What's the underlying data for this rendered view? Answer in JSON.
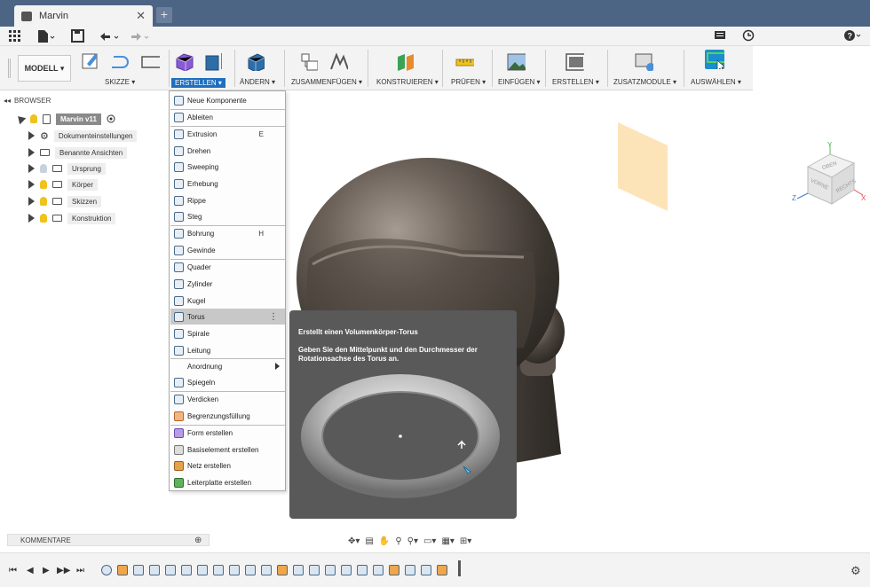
{
  "window": {
    "tab_title": "Marvin",
    "close_glyph": "✕",
    "new_tab_glyph": "+"
  },
  "quickbar": {
    "icons": [
      "grid-icon",
      "file-icon",
      "save-icon",
      "undo-icon",
      "redo-icon",
      "comment-icon",
      "clock-icon",
      "help-icon"
    ]
  },
  "ribbon": {
    "workspace": "MODELL ▾",
    "groups": [
      {
        "label": "SKIZZE ▾"
      },
      {
        "label": "ERSTELLEN ▾"
      },
      {
        "label": "ÄNDERN ▾"
      },
      {
        "label": "ZUSAMMENFÜGEN ▾"
      },
      {
        "label": "KONSTRUIEREN ▾"
      },
      {
        "label": "PRÜFEN ▾"
      },
      {
        "label": "EINFÜGEN ▾"
      },
      {
        "label": "ERSTELLEN ▾"
      },
      {
        "label": "ZUSATZMODULE ▾"
      },
      {
        "label": "AUSWÄHLEN ▾"
      }
    ]
  },
  "viewcube": {
    "top": "OBEN",
    "front": "VORNE",
    "right": "RECHTS",
    "axis_x": "X",
    "axis_y": "Y",
    "axis_z": "Z"
  },
  "browser": {
    "title": "BROWSER",
    "root": "Marvin v11",
    "items": [
      {
        "label": "Dokumenteinstellungen"
      },
      {
        "label": "Benannte Ansichten"
      },
      {
        "label": "Ursprung"
      },
      {
        "label": "Körper"
      },
      {
        "label": "Skizzen"
      },
      {
        "label": "Konstruktion"
      }
    ]
  },
  "menu": {
    "items": [
      {
        "label": "Neue Komponente",
        "key": "",
        "icon": "new-component-icon"
      },
      {
        "label": "Ableiten",
        "key": "",
        "icon": "derive-icon"
      },
      {
        "label": "Extrusion",
        "key": "E",
        "icon": "extrude-icon"
      },
      {
        "label": "Drehen",
        "key": "",
        "icon": "revolve-icon"
      },
      {
        "label": "Sweeping",
        "key": "",
        "icon": "sweep-icon"
      },
      {
        "label": "Erhebung",
        "key": "",
        "icon": "loft-icon"
      },
      {
        "label": "Rippe",
        "key": "",
        "icon": "rib-icon"
      },
      {
        "label": "Steg",
        "key": "",
        "icon": "web-icon"
      },
      {
        "label": "Bohrung",
        "key": "H",
        "icon": "hole-icon"
      },
      {
        "label": "Gewinde",
        "key": "",
        "icon": "thread-icon"
      },
      {
        "label": "Quader",
        "key": "",
        "icon": "box-icon"
      },
      {
        "label": "Zylinder",
        "key": "",
        "icon": "cylinder-icon"
      },
      {
        "label": "Kugel",
        "key": "",
        "icon": "sphere-icon"
      },
      {
        "label": "Torus",
        "key": "",
        "icon": "torus-icon"
      },
      {
        "label": "Spirale",
        "key": "",
        "icon": "coil-icon"
      },
      {
        "label": "Leitung",
        "key": "",
        "icon": "pipe-icon"
      },
      {
        "label": "Anordnung",
        "key": "",
        "icon": "pattern-icon"
      },
      {
        "label": "Spiegeln",
        "key": "",
        "icon": "mirror-icon"
      },
      {
        "label": "Verdicken",
        "key": "",
        "icon": "thicken-icon"
      },
      {
        "label": "Begrenzungsfüllung",
        "key": "",
        "icon": "boundary-fill-icon"
      },
      {
        "label": "Form erstellen",
        "key": "",
        "icon": "create-form-icon"
      },
      {
        "label": "Basiselement erstellen",
        "key": "",
        "icon": "base-feature-icon"
      },
      {
        "label": "Netz erstellen",
        "key": "",
        "icon": "mesh-icon"
      },
      {
        "label": "Leiterplatte erstellen",
        "key": "",
        "icon": "pcb-icon"
      }
    ],
    "more_glyph": "⋮"
  },
  "tooltip": {
    "title": "Erstellt einen Volumenkörper-Torus",
    "description": "Geben Sie den Mittelpunkt und den Durchmesser der Rotationsachse des Torus an."
  },
  "comments": {
    "label": "KOMMENTARE"
  },
  "timeline": {
    "controls": [
      "⏮",
      "◀",
      "▶",
      "▶▶",
      "⏭"
    ]
  },
  "colors": {
    "titlebar": "#4c6584",
    "accent": "#1f6fbf",
    "highlight": "#c8c8c8",
    "tooltip_bg": "#595959",
    "plane": "#fde4b8"
  }
}
